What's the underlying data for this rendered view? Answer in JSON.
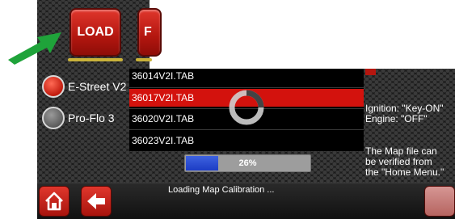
{
  "toolbar": {
    "load_label": "LOAD",
    "next_label_partial": "F"
  },
  "annotation": {
    "arrow_color": "#1fa33a"
  },
  "profiles": [
    {
      "label": "E-Street V2",
      "selected": true
    },
    {
      "label": "Pro-Flo 3",
      "selected": false
    }
  ],
  "files": [
    {
      "name": "36014V2I.TAB",
      "selected": false
    },
    {
      "name": "36017V2I.TAB",
      "selected": true
    },
    {
      "name": "36020V2I.TAB",
      "selected": false
    },
    {
      "name": "36023V2I.TAB",
      "selected": false
    }
  ],
  "progress": {
    "percent": 26,
    "label": "26%"
  },
  "status": {
    "ignition": "Ignition: \"Key-ON\"",
    "engine": "Engine: \"OFF\"",
    "note_line1": "The Map file can",
    "note_line2": "be verified from",
    "note_line3": "the \"Home Menu.\""
  },
  "footer": {
    "status_message": "Loading Map Calibration ..."
  },
  "colors": {
    "accent_red": "#d3120d",
    "progress_blue": "#2a4bd4",
    "background": "#1b1b1b"
  }
}
